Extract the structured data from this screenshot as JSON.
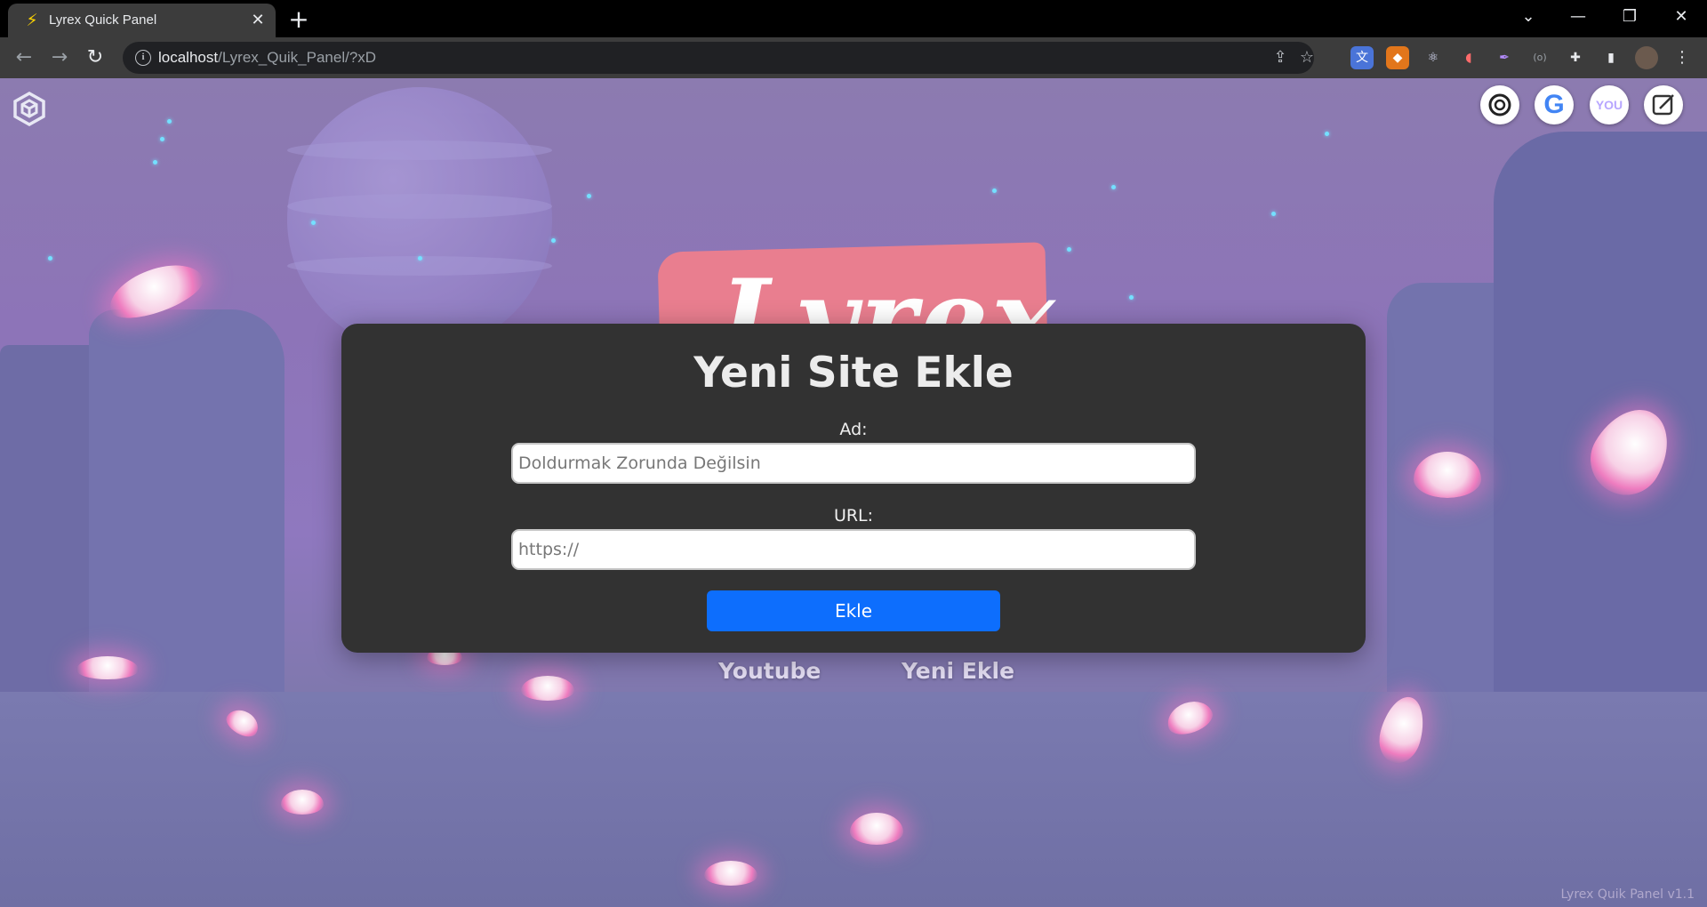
{
  "browser": {
    "tab_title": "Lyrex Quick Panel",
    "url_host": "localhost",
    "url_path": "/Lyrex_Quik_Panel/?xD",
    "tab_favicon": "lightning-icon",
    "extensions": [
      "translate-icon",
      "metamask-icon",
      "react-devtools-icon",
      "extension-icon",
      "feather-icon",
      "bracket-icon",
      "puzzle-icon"
    ]
  },
  "page": {
    "logo_text": "Lyrex",
    "top_left_icon": "cube-icon",
    "quick_icons": [
      "openai-icon",
      "google-icon",
      "you-icon",
      "edit-icon"
    ],
    "you_label": "YOU",
    "google_label": "G",
    "shortcuts": [
      "Youtube",
      "Yeni Ekle"
    ],
    "version": "Lyrex Quik Panel v1.1"
  },
  "modal": {
    "title": "Yeni Site Ekle",
    "name_label": "Ad:",
    "name_placeholder": "Doldurmak Zorunda Değilsin",
    "url_label": "URL:",
    "url_placeholder": "https://",
    "submit_label": "Ekle",
    "submit_color": "#0d6efd"
  }
}
